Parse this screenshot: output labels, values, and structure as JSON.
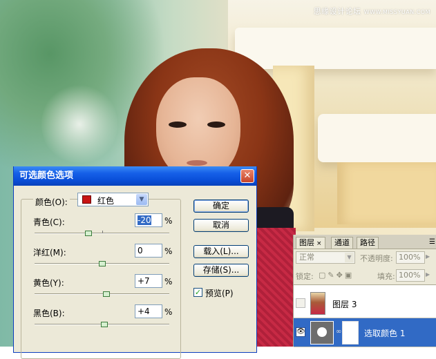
{
  "watermark": {
    "text": "思缘设计论坛",
    "url": "WWW.MISSYUAN.COM"
  },
  "dialog": {
    "title": "可选颜色选项",
    "colors_label": "颜色(O):",
    "colors_value": "红色",
    "swatch_color": "#c81414",
    "sliders": [
      {
        "label": "青色(C):",
        "value": "-20",
        "unit": "%",
        "level": -20
      },
      {
        "label": "洋红(M):",
        "value": "0",
        "unit": "%",
        "level": 0
      },
      {
        "label": "黄色(Y):",
        "value": "+7",
        "unit": "%",
        "level": 7
      },
      {
        "label": "黑色(B):",
        "value": "+4",
        "unit": "%",
        "level": 4
      }
    ],
    "buttons": {
      "ok": "确定",
      "cancel": "取消",
      "load": "载入(L)...",
      "save": "存储(S)..."
    },
    "preview_label": "预览(P)",
    "preview_checked": true
  },
  "layers_panel": {
    "tabs": [
      "图层",
      "通道",
      "路径"
    ],
    "tab_close": "×",
    "blend_mode": "正常",
    "opacity_label": "不透明度:",
    "opacity_value": "100%",
    "lock_label": "锁定:",
    "fill_label": "填充:",
    "fill_value": "100%",
    "layers": [
      {
        "name": "图层 3",
        "selected": false,
        "visible": false
      },
      {
        "name": "选取颜色 1",
        "selected": true,
        "visible": true
      }
    ]
  },
  "colors": {
    "titlebar": "#0a4fd9",
    "selection": "#316ac5"
  }
}
